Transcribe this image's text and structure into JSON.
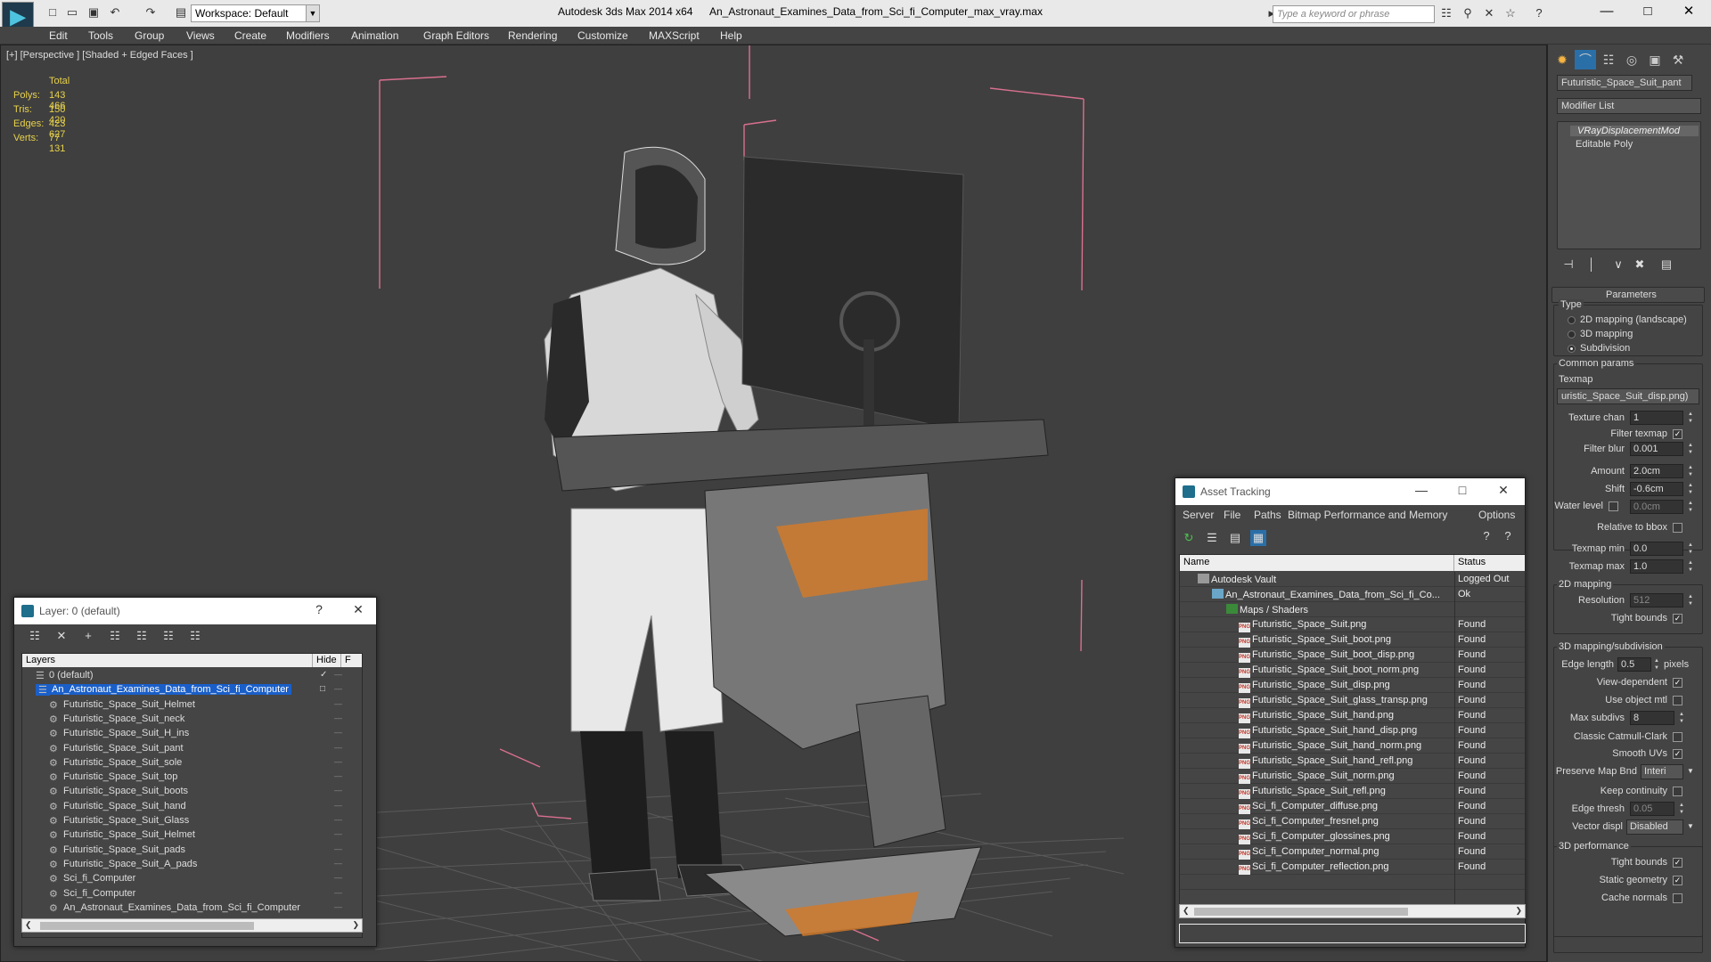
{
  "window": {
    "app_title": "Autodesk 3ds Max  2014 x64",
    "document": "An_Astronaut_Examines_Data_from_Sci_fi_Computer_max_vray.max",
    "workspace": "Workspace: Default",
    "search_placeholder": "Type a keyword or phrase"
  },
  "menu": [
    "Edit",
    "Tools",
    "Group",
    "Views",
    "Create",
    "Modifiers",
    "Animation",
    "Graph Editors",
    "Rendering",
    "Customize",
    "MAXScript",
    "Help"
  ],
  "viewport": {
    "label": "[+] [Perspective ] [Shaded + Edged Faces ]",
    "stats": {
      "header": "Total",
      "rows": [
        {
          "label": "Polys:",
          "value": "143 466"
        },
        {
          "label": "Tris:",
          "value": "150 420"
        },
        {
          "label": "Edges:",
          "value": "423 627"
        },
        {
          "label": "Verts:",
          "value": "77 131"
        }
      ]
    }
  },
  "command_panel": {
    "object_name": "Futuristic_Space_Suit_pant",
    "modifier_list": "Modifier List",
    "stack": [
      "VRayDisplacementMod",
      "Editable Poly"
    ],
    "parameters_title": "Parameters",
    "type_label": "Type",
    "type_options": [
      "2D mapping (landscape)",
      "3D mapping",
      "Subdivision"
    ],
    "type_selected": "Subdivision",
    "common_params": "Common params",
    "texmap_label": "Texmap",
    "texmap_value": "uristic_Space_Suit_disp.png)",
    "texture_chan_label": "Texture chan",
    "texture_chan": "1",
    "filter_texmap": "Filter texmap",
    "filter_blur_label": "Filter blur",
    "filter_blur": "0.001",
    "amount_label": "Amount",
    "amount": "2.0cm",
    "shift_label": "Shift",
    "shift": "-0.6cm",
    "water_level_label": "Water level",
    "water_level": "0.0cm",
    "relative_bbox": "Relative to bbox",
    "texmap_min_label": "Texmap min",
    "texmap_min": "0.0",
    "texmap_max_label": "Texmap max",
    "texmap_max": "1.0",
    "mapping_2d": "2D mapping",
    "resolution_label": "Resolution",
    "resolution": "512",
    "tight_bounds": "Tight bounds",
    "mapping_3d": "3D mapping/subdivision",
    "edge_length_label": "Edge length",
    "edge_length": "0.5",
    "pixels": "pixels",
    "view_dependent": "View-dependent",
    "use_object_mtl": "Use object mtl",
    "max_subdivs_label": "Max subdivs",
    "max_subdivs": "8",
    "classic_catmull": "Classic Catmull-Clark",
    "smooth_uvs": "Smooth UVs",
    "preserve_map_label": "Preserve Map Bnd",
    "preserve_map": "Interi",
    "keep_continuity": "Keep continuity",
    "edge_thresh_label": "Edge thresh",
    "edge_thresh": "0.05",
    "vector_displ_label": "Vector displ",
    "vector_displ": "Disabled",
    "performance_3d": "3D performance",
    "tight_bounds2": "Tight bounds",
    "static_geometry": "Static geometry",
    "cache_normals": "Cache normals"
  },
  "layer_dialog": {
    "title": "Layer: 0 (default)",
    "col_layers": "Layers",
    "col_hide": "Hide",
    "col_f": "F",
    "rows": [
      {
        "name": "0 (default)",
        "indent": 0,
        "selected": false
      },
      {
        "name": "An_Astronaut_Examines_Data_from_Sci_fi_Computer",
        "indent": 0,
        "selected": true
      },
      {
        "name": "Futuristic_Space_Suit_Helmet",
        "indent": 1,
        "selected": false
      },
      {
        "name": "Futuristic_Space_Suit_neck",
        "indent": 1,
        "selected": false
      },
      {
        "name": "Futuristic_Space_Suit_H_ins",
        "indent": 1,
        "selected": false
      },
      {
        "name": "Futuristic_Space_Suit_pant",
        "indent": 1,
        "selected": false
      },
      {
        "name": "Futuristic_Space_Suit_sole",
        "indent": 1,
        "selected": false
      },
      {
        "name": "Futuristic_Space_Suit_top",
        "indent": 1,
        "selected": false
      },
      {
        "name": "Futuristic_Space_Suit_boots",
        "indent": 1,
        "selected": false
      },
      {
        "name": "Futuristic_Space_Suit_hand",
        "indent": 1,
        "selected": false
      },
      {
        "name": "Futuristic_Space_Suit_Glass",
        "indent": 1,
        "selected": false
      },
      {
        "name": "Futuristic_Space_Suit_Helmet",
        "indent": 1,
        "selected": false
      },
      {
        "name": "Futuristic_Space_Suit_pads",
        "indent": 1,
        "selected": false
      },
      {
        "name": "Futuristic_Space_Suit_A_pads",
        "indent": 1,
        "selected": false
      },
      {
        "name": "Sci_fi_Computer",
        "indent": 1,
        "selected": false
      },
      {
        "name": "Sci_fi_Computer",
        "indent": 1,
        "selected": false
      },
      {
        "name": "An_Astronaut_Examines_Data_from_Sci_fi_Computer",
        "indent": 1,
        "selected": false
      }
    ]
  },
  "asset_dialog": {
    "title": "Asset Tracking",
    "menu": [
      "Server",
      "File",
      "Paths",
      "Bitmap Performance and Memory",
      "Options"
    ],
    "col_name": "Name",
    "col_status": "Status",
    "rows": [
      {
        "name": "Autodesk Vault",
        "status": "Logged Out",
        "level": 0,
        "icon": "vault"
      },
      {
        "name": "An_Astronaut_Examines_Data_from_Sci_fi_Co...",
        "status": "Ok",
        "level": 1,
        "icon": "max"
      },
      {
        "name": "Maps / Shaders",
        "status": "",
        "level": 2,
        "icon": "maps"
      },
      {
        "name": "Futuristic_Space_Suit.png",
        "status": "Found",
        "level": 3,
        "icon": "png"
      },
      {
        "name": "Futuristic_Space_Suit_boot.png",
        "status": "Found",
        "level": 3,
        "icon": "png"
      },
      {
        "name": "Futuristic_Space_Suit_boot_disp.png",
        "status": "Found",
        "level": 3,
        "icon": "png"
      },
      {
        "name": "Futuristic_Space_Suit_boot_norm.png",
        "status": "Found",
        "level": 3,
        "icon": "png"
      },
      {
        "name": "Futuristic_Space_Suit_disp.png",
        "status": "Found",
        "level": 3,
        "icon": "png"
      },
      {
        "name": "Futuristic_Space_Suit_glass_transp.png",
        "status": "Found",
        "level": 3,
        "icon": "png"
      },
      {
        "name": "Futuristic_Space_Suit_hand.png",
        "status": "Found",
        "level": 3,
        "icon": "png"
      },
      {
        "name": "Futuristic_Space_Suit_hand_disp.png",
        "status": "Found",
        "level": 3,
        "icon": "png"
      },
      {
        "name": "Futuristic_Space_Suit_hand_norm.png",
        "status": "Found",
        "level": 3,
        "icon": "png"
      },
      {
        "name": "Futuristic_Space_Suit_hand_refl.png",
        "status": "Found",
        "level": 3,
        "icon": "png"
      },
      {
        "name": "Futuristic_Space_Suit_norm.png",
        "status": "Found",
        "level": 3,
        "icon": "png"
      },
      {
        "name": "Futuristic_Space_Suit_refl.png",
        "status": "Found",
        "level": 3,
        "icon": "png"
      },
      {
        "name": "Sci_fi_Computer_diffuse.png",
        "status": "Found",
        "level": 3,
        "icon": "png"
      },
      {
        "name": "Sci_fi_Computer_fresnel.png",
        "status": "Found",
        "level": 3,
        "icon": "png"
      },
      {
        "name": "Sci_fi_Computer_glossines.png",
        "status": "Found",
        "level": 3,
        "icon": "png"
      },
      {
        "name": "Sci_fi_Computer_normal.png",
        "status": "Found",
        "level": 3,
        "icon": "png"
      },
      {
        "name": "Sci_fi_Computer_reflection.png",
        "status": "Found",
        "level": 3,
        "icon": "png"
      }
    ]
  },
  "colors": {
    "stats_yellow": "#e8d24b",
    "selection_blue": "#1a5fc9",
    "bbox_pink": "#d9708f",
    "suit_orange": "#d07a2c"
  }
}
